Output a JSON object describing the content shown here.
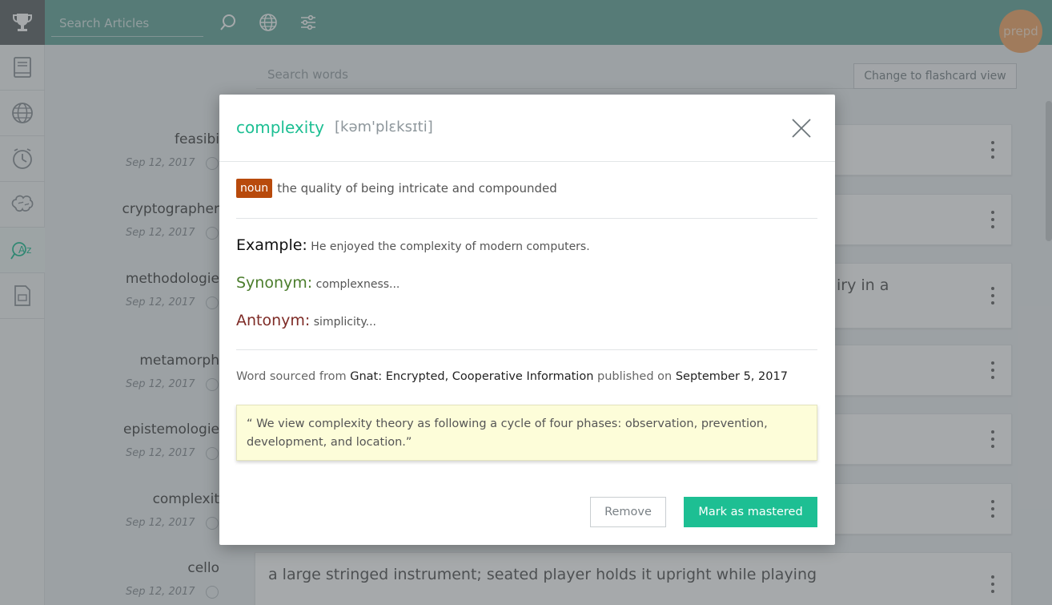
{
  "topbar": {
    "search_placeholder": "Search Articles",
    "avatar_text": "prepd"
  },
  "sidebar": {
    "items": [
      {
        "icon": "book-icon"
      },
      {
        "icon": "globe-icon"
      },
      {
        "icon": "clock-icon"
      },
      {
        "icon": "brain-icon"
      },
      {
        "icon": "vocabulary-icon"
      },
      {
        "icon": "document-icon"
      }
    ]
  },
  "main": {
    "search_placeholder": "Search words",
    "flashcard_button": "Change to flashcard view",
    "words": [
      {
        "word": "feasibi",
        "date": "Sep 12, 2017",
        "definition": ""
      },
      {
        "word": "cryptographer",
        "date": "Sep 12, 2017",
        "definition": ""
      },
      {
        "word": "methodologie",
        "date": "Sep 12, 2017",
        "definition": "iry in a"
      },
      {
        "word": "metamorph",
        "date": "Sep 12, 2017",
        "definition": ""
      },
      {
        "word": "epistemologie",
        "date": "Sep 12, 2017",
        "definition": ""
      },
      {
        "word": "complexit",
        "date": "Sep 12, 2017",
        "definition": ""
      },
      {
        "word": "cello",
        "date": "Sep 12, 2017",
        "definition": "a large stringed instrument; seated player holds it upright while playing"
      }
    ]
  },
  "modal": {
    "word": "complexity",
    "pronunciation": "[kəm'plɛksɪti]",
    "part_of_speech": "noun",
    "definition": "the quality of being intricate and compounded",
    "example_label": "Example:",
    "example": "He enjoyed the complexity of modern computers.",
    "synonym_label": "Synonym:",
    "synonym": "complexness...",
    "antonym_label": "Antonym:",
    "antonym": "simplicity...",
    "source_prefix": "Word sourced from",
    "source_name": "Gnat: Encrypted, Cooperative Information",
    "published_prefix": "published on",
    "published_date": "September 5, 2017",
    "quote": "“ We view complexity theory as following a cycle of four phases: observation, prevention, development, and location.”",
    "remove_label": "Remove",
    "mastered_label": "Mark as mastered"
  },
  "colors": {
    "topbar": "#67a79c",
    "accent": "#1dbf93",
    "noun_badge": "#b84a0c",
    "synonym": "#4b7d2c",
    "antonym": "#7e2b26"
  }
}
